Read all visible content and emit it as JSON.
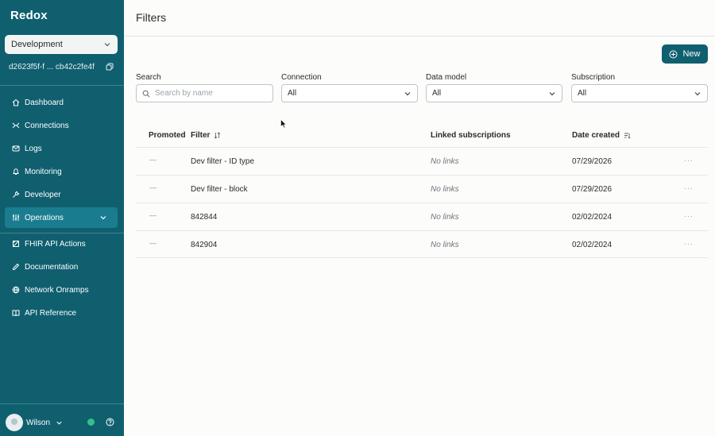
{
  "sidebar": {
    "logo": "Redox",
    "environment": "Development",
    "environment_id": "d2623f5f-f ... cb42c2fe4f",
    "items": [
      {
        "label": "Dashboard",
        "icon": "home-icon"
      },
      {
        "label": "Connections",
        "icon": "connections-icon"
      },
      {
        "label": "Logs",
        "icon": "mail-icon"
      },
      {
        "label": "Monitoring",
        "icon": "bell-icon"
      },
      {
        "label": "Developer",
        "icon": "wrench-icon"
      },
      {
        "label": "Operations",
        "icon": "sliders-icon",
        "active": true
      },
      {
        "label": "FHIR API Actions",
        "icon": "fhir-icon"
      },
      {
        "label": "Documentation",
        "icon": "pen-icon"
      },
      {
        "label": "Network Onramps",
        "icon": "globe-icon"
      },
      {
        "label": "API Reference",
        "icon": "book-icon"
      }
    ],
    "user": {
      "name": "Wilson",
      "status_color": "#35c08a"
    }
  },
  "main": {
    "title": "Filters",
    "new_button": "New",
    "search": {
      "label": "Search",
      "placeholder": "Search by name"
    },
    "connection": {
      "label": "Connection",
      "value": "All"
    },
    "data_model": {
      "label": "Data model",
      "value": "All"
    },
    "subscription": {
      "label": "Subscription",
      "value": "All"
    },
    "table": {
      "columns": [
        "Promoted",
        "Filter",
        "Linked subscriptions",
        "Date created"
      ],
      "rows": [
        {
          "promoted": "—",
          "filter": "Dev filter - ID type",
          "links": "No links",
          "date": "07/29/2026",
          "more": "···"
        },
        {
          "promoted": "—",
          "filter": "Dev filter - block",
          "links": "No links",
          "date": "07/29/2026",
          "more": "···"
        },
        {
          "promoted": "—",
          "filter": "842844",
          "links": "No links",
          "date": "02/02/2024",
          "more": "···"
        },
        {
          "promoted": "—",
          "filter": "842904",
          "links": "No links",
          "date": "02/02/2024",
          "more": "···"
        }
      ]
    }
  },
  "colors": {
    "sidebar": "#0f5f6f",
    "accent": "#0f5f6f",
    "active_item": "#1a7d8f"
  }
}
